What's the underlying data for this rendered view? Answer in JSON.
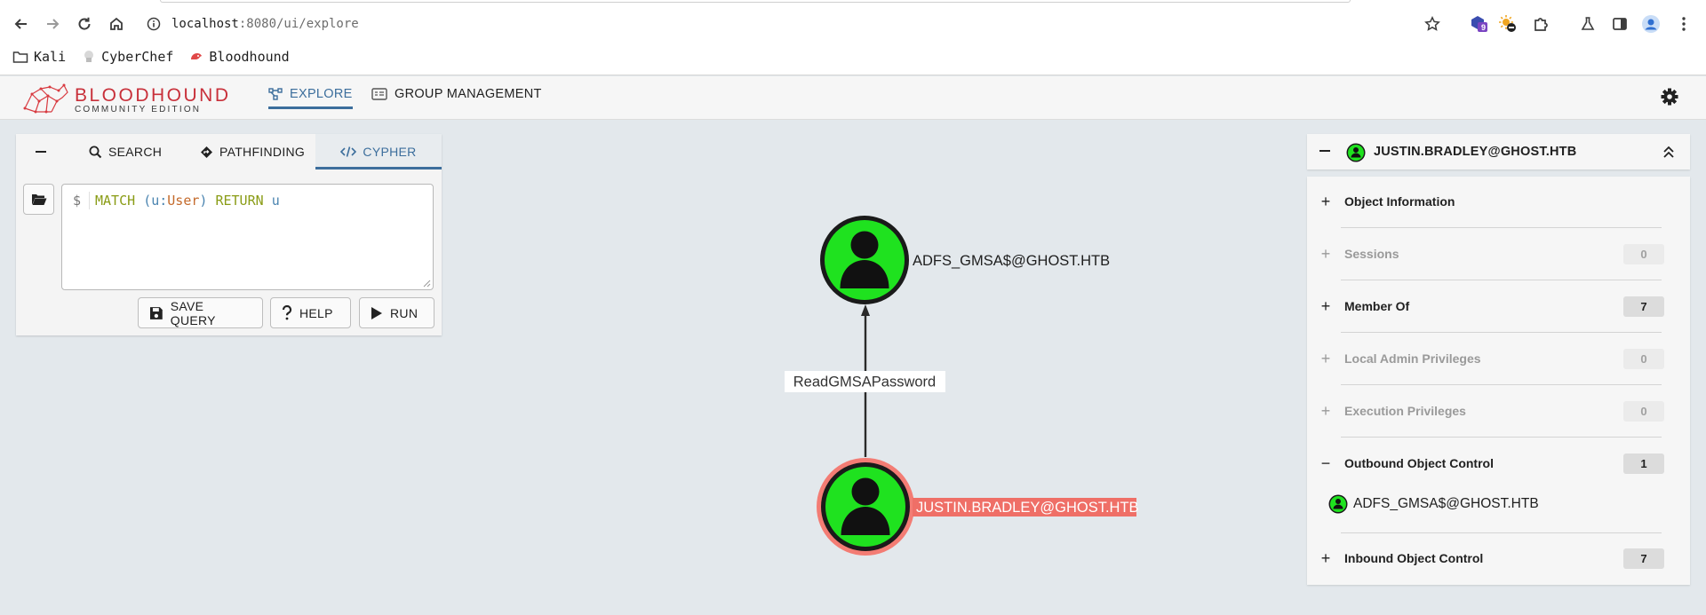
{
  "browser": {
    "url_host": "localhost",
    "url_rest": ":8080/ui/explore",
    "extension_badge": "9",
    "bookmarks": [
      {
        "label": "Kali",
        "icon": "folder-icon"
      },
      {
        "label": "CyberChef",
        "icon": "cyberchef-icon"
      },
      {
        "label": "Bloodhound",
        "icon": "bloodhound-icon"
      }
    ]
  },
  "app": {
    "logo_main": "BLOODHOUND",
    "logo_sub": "COMMUNITY EDITION",
    "nav": [
      {
        "label": "EXPLORE",
        "active": true
      },
      {
        "label": "GROUP MANAGEMENT",
        "active": false
      }
    ]
  },
  "query_panel": {
    "tabs": [
      {
        "label": "SEARCH"
      },
      {
        "label": "PATHFINDING"
      },
      {
        "label": "CYPHER",
        "active": true
      }
    ],
    "prompt": "$",
    "code": {
      "kw1": "MATCH",
      "open": "(",
      "var": "u",
      "colon": ":",
      "label": "User",
      "close": ")",
      "kw2": "RETURN",
      "ret": "u"
    },
    "buttons": {
      "save": "SAVE QUERY",
      "help": "HELP",
      "run": "RUN"
    }
  },
  "graph": {
    "nodes": [
      {
        "id": "target",
        "label": "ADFS_GMSA$@GHOST.HTB",
        "selected": false
      },
      {
        "id": "source",
        "label": "JUSTIN.BRADLEY@GHOST.HTB",
        "selected": true
      }
    ],
    "edge": {
      "label": "ReadGMSAPassword"
    },
    "colors": {
      "node_fill": "#1fe21f",
      "selected_ring": "#f37c74",
      "selected_label_bg": "#ef6f67"
    }
  },
  "entity_panel": {
    "title": "JUSTIN.BRADLEY@GHOST.HTB",
    "sections": [
      {
        "name": "Object Information",
        "symbol": "+",
        "count": null,
        "disabled": false
      },
      {
        "name": "Sessions",
        "symbol": "+",
        "count": "0",
        "disabled": true
      },
      {
        "name": "Member Of",
        "symbol": "+",
        "count": "7",
        "disabled": false
      },
      {
        "name": "Local Admin Privileges",
        "symbol": "+",
        "count": "0",
        "disabled": true
      },
      {
        "name": "Execution Privileges",
        "symbol": "+",
        "count": "0",
        "disabled": true
      },
      {
        "name": "Outbound Object Control",
        "symbol": "−",
        "count": "1",
        "disabled": false
      },
      {
        "name": "Inbound Object Control",
        "symbol": "+",
        "count": "7",
        "disabled": false
      }
    ],
    "outbound_item": "ADFS_GMSA$@GHOST.HTB"
  }
}
